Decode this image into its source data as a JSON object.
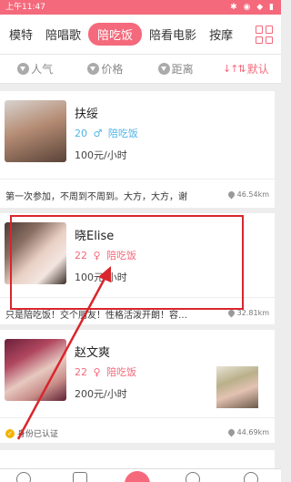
{
  "status": {
    "time": "上午11:47",
    "icons": "✱ ◉ ◆ ▮"
  },
  "tabs": [
    {
      "label": "模特",
      "active": false
    },
    {
      "label": "陪唱歌",
      "active": false
    },
    {
      "label": "陪吃饭",
      "active": true
    },
    {
      "label": "陪看电影",
      "active": false
    },
    {
      "label": "按摩",
      "active": false
    }
  ],
  "sort": [
    {
      "label": "人气",
      "icon": "dropdown-icon"
    },
    {
      "label": "价格",
      "icon": "dropdown-icon"
    },
    {
      "label": "距离",
      "icon": "dropdown-icon"
    },
    {
      "label": "默认",
      "icon": "sort-icon",
      "active": true
    }
  ],
  "listings": [
    {
      "name": "扶绥",
      "age": "20",
      "gender": "♂",
      "service": "陪吃饭",
      "price": "100元/小时",
      "desc": "第一次参加，不周到不周到。大方，大方，谢",
      "distance": "46.54km"
    },
    {
      "name": "晓Elise",
      "age": "22",
      "gender": "♀",
      "service": "陪吃饭",
      "price": "100元/小时",
      "desc": "只是陪吃饭！交个朋友！性格活泼开朗！容…",
      "distance": "32.81km"
    },
    {
      "name": "赵文爽",
      "age": "22",
      "gender": "♀",
      "service": "陪吃饭",
      "price": "200元/小时",
      "badge": "身份已认证",
      "distance": "44.69km"
    }
  ],
  "colors": {
    "accent": "#f4697b",
    "male": "#4fb4e8",
    "highlight": "#d9262c"
  }
}
